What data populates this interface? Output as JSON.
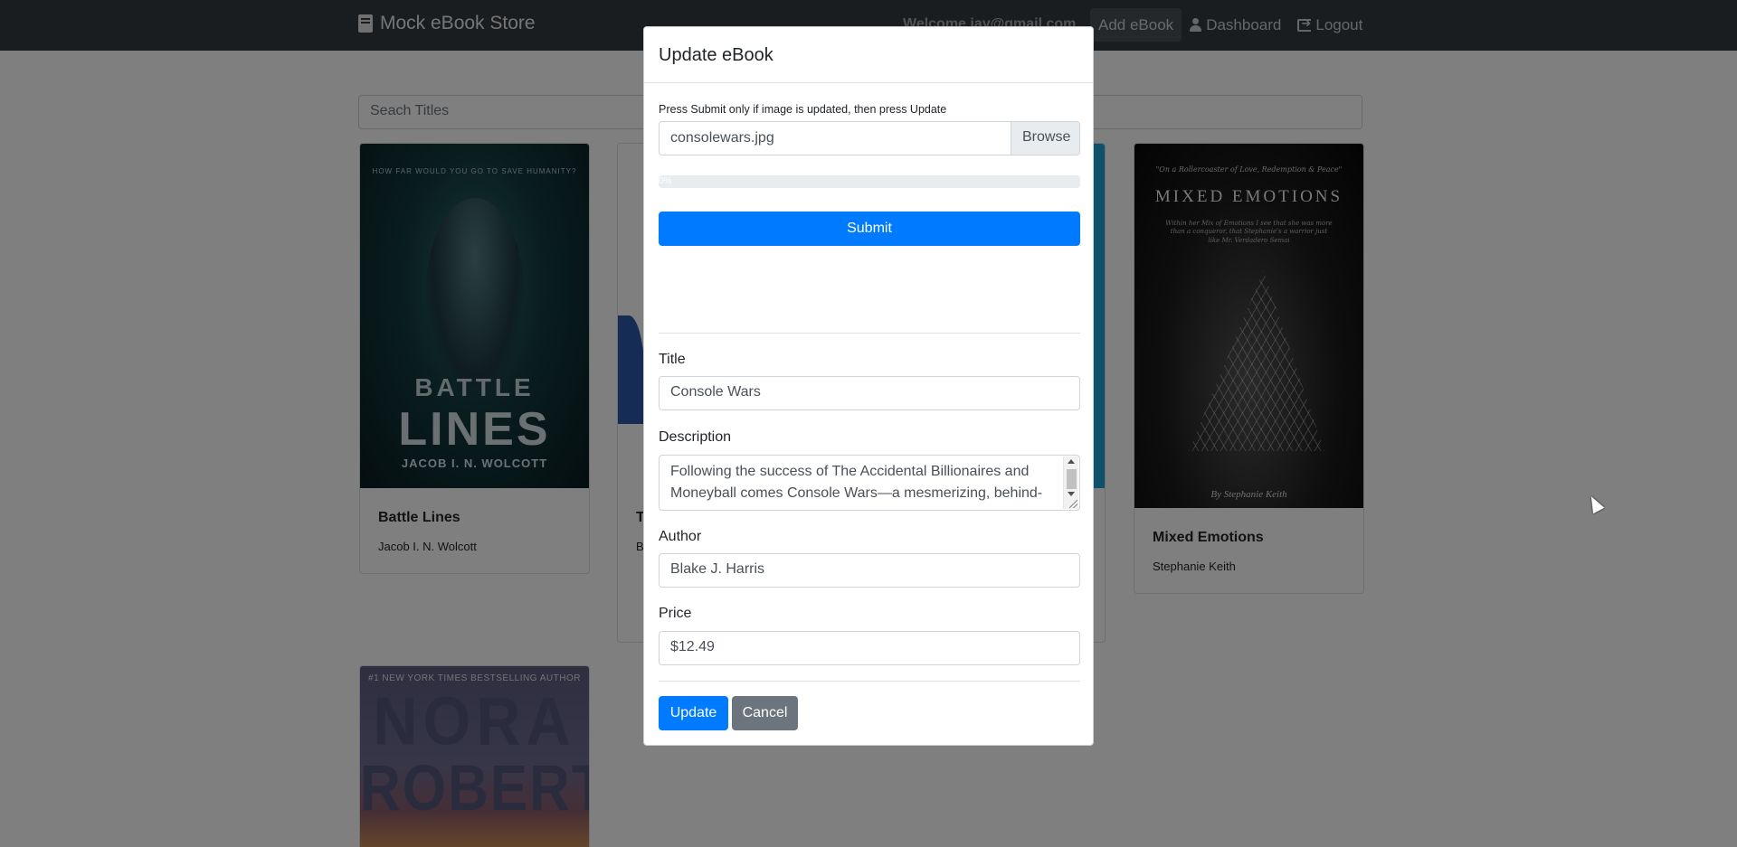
{
  "navbar": {
    "brand": "Mock eBook Store",
    "welcome": "Welcome jay@gmail.com",
    "add_ebook": "Add eBook",
    "dashboard": "Dashboard",
    "logout": "Logout"
  },
  "search": {
    "placeholder": "Seach Titles"
  },
  "books": [
    {
      "title": "Battle Lines",
      "author": "Jacob I. N. Wolcott",
      "cover_tagline": "HOW FAR WOULD YOU GO TO SAVE HUMANITY?",
      "cover_title_1": "BATTLE",
      "cover_title_2": "LINES",
      "cover_author": "JACOB I. N. WOLCOTT"
    },
    {
      "title": "T",
      "author": "B"
    },
    {
      "title": "Mixed Emotions",
      "author": "Stephanie Keith",
      "cover_tagline": "\"On a Rollercoaster of Love, Redemption & Peace\"",
      "cover_title": "MIXED EMOTIONS",
      "cover_blurb": "Within her Mix of Emotions I see that she was more than a conqueror, that Stephanie's a warrior just like Mr. Verdadero Semai",
      "cover_author": "By Stephanie Keith"
    },
    {
      "cover_tagline": "#1 NEW YORK TIMES BESTSELLING AUTHOR",
      "cover_title_1": "NORA",
      "cover_title_2": "ROBERTS"
    }
  ],
  "modal": {
    "title": "Update eBook",
    "hint": "Press Submit only if image is updated, then press Update",
    "file_name": "consolewars.jpg",
    "browse": "Browse",
    "progress_label": "0%",
    "progress_fraction": 0,
    "submit": "Submit",
    "title_label": "Title",
    "title_value": "Console Wars",
    "description_label": "Description",
    "description_value": "Following the success of The Accidental Billionaires and Moneyball comes Console Wars—a mesmerizing, behind-",
    "author_label": "Author",
    "author_value": "Blake J. Harris",
    "price_label": "Price",
    "price_value": "$12.49",
    "update": "Update",
    "cancel": "Cancel"
  },
  "colors": {
    "primary": "#007bff",
    "secondary": "#6c757d",
    "navbar": "#343a40"
  }
}
